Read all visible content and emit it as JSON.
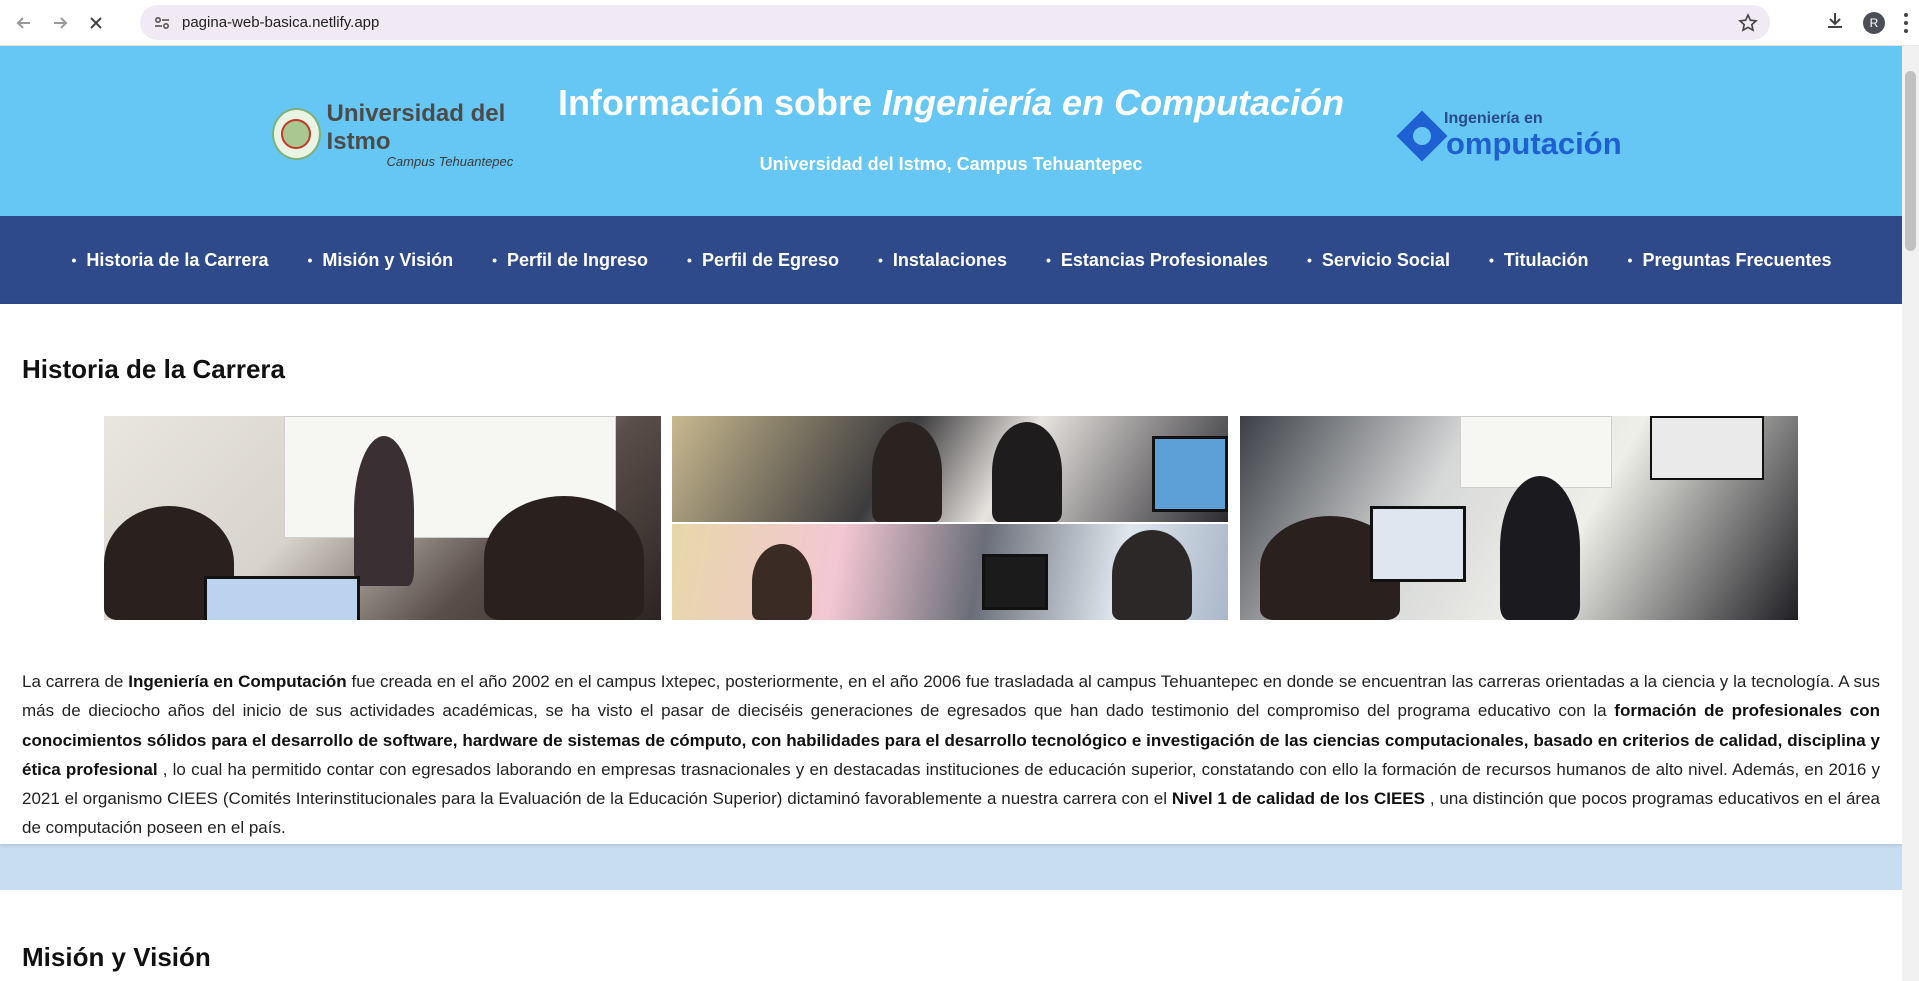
{
  "browser": {
    "url": "pagina-web-basica.netlify.app",
    "avatar_initial": "R"
  },
  "header": {
    "logo_left_name": "Universidad del Istmo",
    "logo_left_campus": "Campus Tehuantepec",
    "title_plain": "Información sobre ",
    "title_em": "Ingeniería en Computación",
    "subtitle": "Universidad del Istmo, Campus Tehuantepec",
    "logo_right_small": "Ingeniería en",
    "logo_right_big": "omputación"
  },
  "nav": {
    "items": [
      {
        "label": "Historia de la Carrera"
      },
      {
        "label": "Misión y Visión"
      },
      {
        "label": "Perfil de Ingreso"
      },
      {
        "label": "Perfil de Egreso"
      },
      {
        "label": "Instalaciones"
      },
      {
        "label": "Estancias Profesionales"
      },
      {
        "label": "Servicio Social"
      },
      {
        "label": "Titulación"
      },
      {
        "label": "Preguntas Frecuentes"
      }
    ]
  },
  "historia": {
    "heading": "Historia de la Carrera",
    "p_1": "La carrera de ",
    "b_1": "Ingeniería en Computación",
    "p_2": " fue creada en el año 2002 en el campus Ixtepec, posteriormente, en el año 2006 fue trasladada al campus Tehuantepec en donde se encuentran las carreras orientadas a la ciencia y la tecnología. A sus más de dieciocho años del inicio de sus actividades académicas, se ha visto el pasar de dieciséis generaciones de egresados que han dado testimonio del compromiso del programa educativo con la ",
    "b_2": "formación de profesionales con conocimientos sólidos para el desarrollo de software, hardware de sistemas de cómputo, con habilidades para el desarrollo tecnológico e investigación de las ciencias computacionales, basado en criterios de calidad, disciplina y ética profesional",
    "p_3": " , lo cual ha permitido contar con egresados laborando en empresas trasnacionales y en destacadas instituciones de educación superior, constatando con ello la formación de recursos humanos de alto nivel. Además, en 2016 y 2021 el organismo CIEES (Comités Interinstitucionales para la Evaluación de la Educación Superior) dictaminó favorablemente a nuestra carrera con el ",
    "b_3": "Nivel 1 de calidad de los CIEES",
    "p_4": " , una distinción que pocos programas educativos en el área de computación poseen en el país."
  },
  "mision": {
    "heading": "Misión y Visión"
  }
}
